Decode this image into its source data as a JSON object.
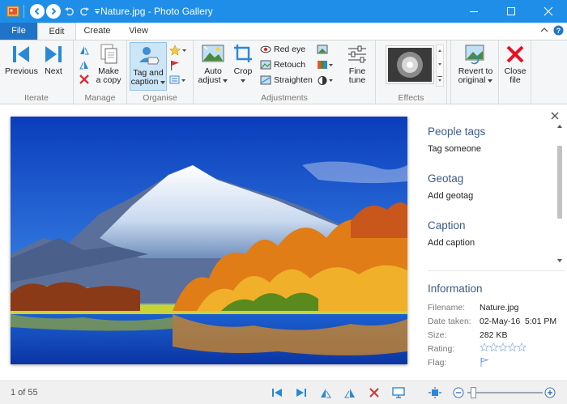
{
  "window": {
    "title": "Nature.jpg - Photo Gallery",
    "accent_color": "#1f8ee8",
    "file_tab_color": "#1f74c7"
  },
  "quick_access": {
    "icons": [
      "app-icon",
      "back-icon",
      "forward-icon",
      "undo-icon",
      "redo-icon",
      "customize-icon"
    ]
  },
  "window_controls": {
    "icons": [
      "minimize-icon",
      "maximize-icon",
      "close-icon"
    ]
  },
  "tabs": [
    {
      "label": "File",
      "active": false
    },
    {
      "label": "Edit",
      "active": true
    },
    {
      "label": "Create",
      "active": false
    },
    {
      "label": "View",
      "active": false
    }
  ],
  "ribbon": {
    "iterate": {
      "label": "Iterate",
      "previous": "Previous",
      "next": "Next"
    },
    "manage": {
      "label": "Manage",
      "make_copy_line1": "Make",
      "make_copy_line2": "a copy"
    },
    "organise": {
      "label": "Organise",
      "tag_line1": "Tag and",
      "tag_line2": "caption"
    },
    "adjustments": {
      "label": "Adjustments",
      "auto_adjust_line1": "Auto",
      "auto_adjust_line2": "adjust",
      "crop": "Crop",
      "red_eye": "Red eye",
      "retouch": "Retouch",
      "straighten": "Straighten",
      "fine_tune_line1": "Fine",
      "fine_tune_line2": "tune"
    },
    "effects": {
      "label": "Effects"
    },
    "revert": {
      "line1": "Revert to",
      "line2": "original"
    },
    "close": {
      "line1": "Close",
      "line2": "file"
    }
  },
  "details_panel": {
    "people_tags": {
      "title": "People tags",
      "action": "Tag someone"
    },
    "geotag": {
      "title": "Geotag",
      "action": "Add geotag"
    },
    "caption": {
      "title": "Caption",
      "action": "Add caption"
    },
    "information": {
      "title": "Information",
      "fields": [
        {
          "label": "Filename:",
          "value": "Nature.jpg"
        },
        {
          "label": "Date taken:",
          "value": "02-May-16  5:01 PM"
        },
        {
          "label": "Size:",
          "value": "282 KB"
        },
        {
          "label": "Rating:",
          "value": ""
        },
        {
          "label": "Flag:",
          "value": ""
        }
      ],
      "rating_stars": 0,
      "rating_max": 5
    }
  },
  "status": {
    "count": "1 of 55",
    "zoom_fraction": 0.05
  }
}
